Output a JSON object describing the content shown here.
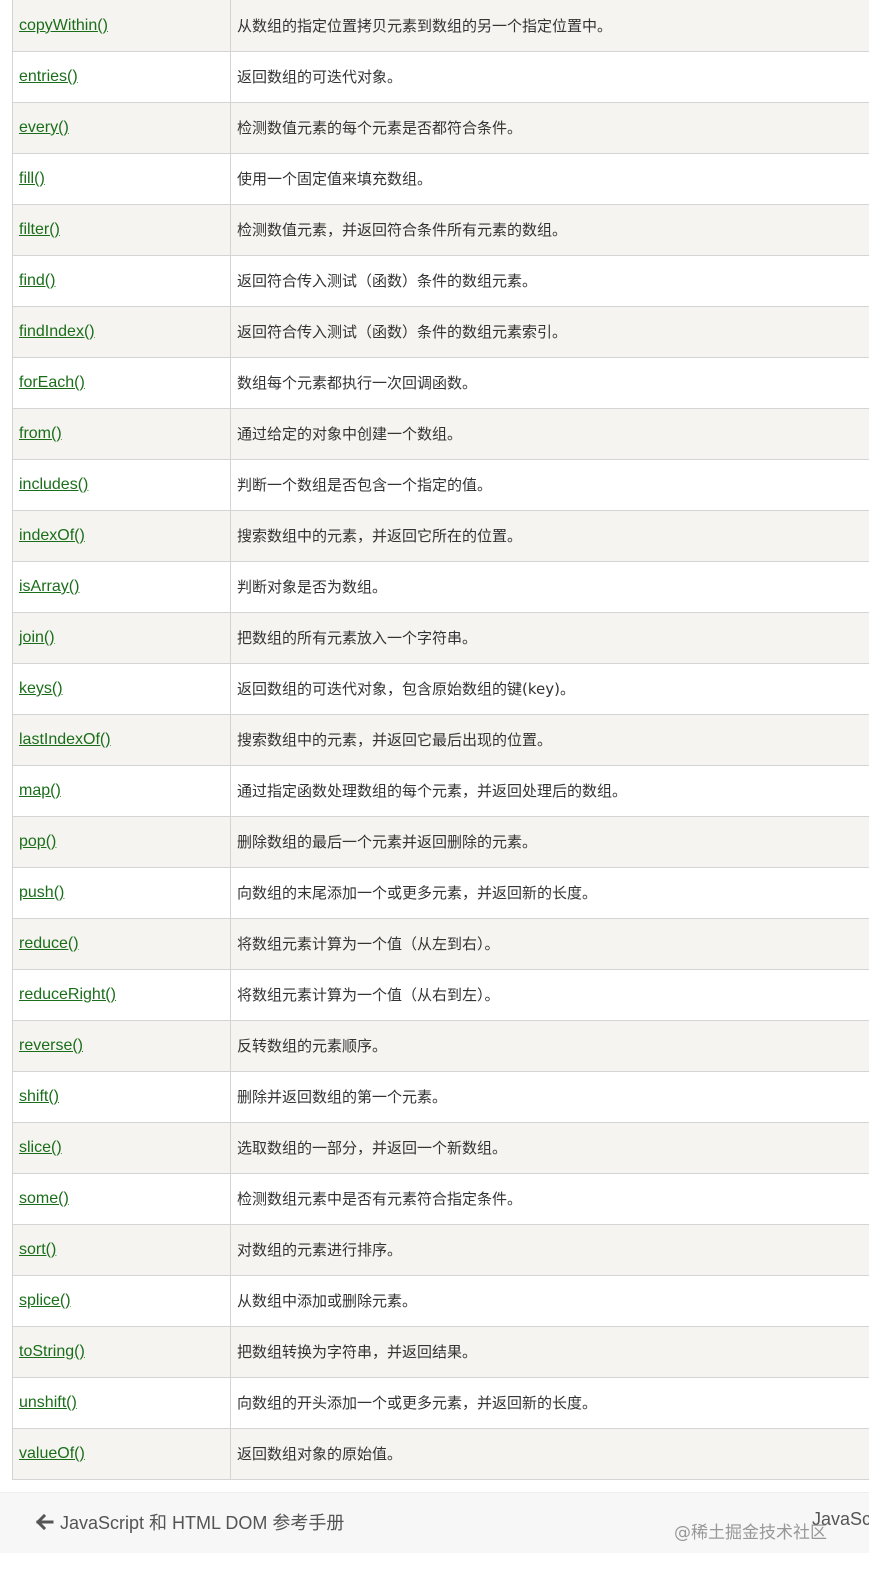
{
  "methods": [
    {
      "name": "copyWithin()",
      "desc": "从数组的指定位置拷贝元素到数组的另一个指定位置中。"
    },
    {
      "name": "entries()",
      "desc": "返回数组的可迭代对象。"
    },
    {
      "name": "every()",
      "desc": "检测数值元素的每个元素是否都符合条件。"
    },
    {
      "name": "fill()",
      "desc": "使用一个固定值来填充数组。"
    },
    {
      "name": "filter()",
      "desc": "检测数值元素，并返回符合条件所有元素的数组。"
    },
    {
      "name": "find()",
      "desc": "返回符合传入测试（函数）条件的数组元素。"
    },
    {
      "name": "findIndex()",
      "desc": "返回符合传入测试（函数）条件的数组元素索引。"
    },
    {
      "name": "forEach()",
      "desc": "数组每个元素都执行一次回调函数。"
    },
    {
      "name": "from()",
      "desc": "通过给定的对象中创建一个数组。"
    },
    {
      "name": "includes()",
      "desc": "判断一个数组是否包含一个指定的值。"
    },
    {
      "name": "indexOf()",
      "desc": "搜索数组中的元素，并返回它所在的位置。"
    },
    {
      "name": "isArray()",
      "desc": "判断对象是否为数组。"
    },
    {
      "name": "join()",
      "desc": "把数组的所有元素放入一个字符串。"
    },
    {
      "name": "keys()",
      "desc": "返回数组的可迭代对象，包含原始数组的键(key)。"
    },
    {
      "name": "lastIndexOf()",
      "desc": "搜索数组中的元素，并返回它最后出现的位置。"
    },
    {
      "name": "map()",
      "desc": "通过指定函数处理数组的每个元素，并返回处理后的数组。"
    },
    {
      "name": "pop()",
      "desc": "删除数组的最后一个元素并返回删除的元素。"
    },
    {
      "name": "push()",
      "desc": "向数组的末尾添加一个或更多元素，并返回新的长度。"
    },
    {
      "name": "reduce()",
      "desc": "将数组元素计算为一个值（从左到右）。"
    },
    {
      "name": "reduceRight()",
      "desc": "将数组元素计算为一个值（从右到左）。"
    },
    {
      "name": "reverse()",
      "desc": "反转数组的元素顺序。"
    },
    {
      "name": "shift()",
      "desc": "删除并返回数组的第一个元素。"
    },
    {
      "name": "slice()",
      "desc": "选取数组的一部分，并返回一个新数组。"
    },
    {
      "name": "some()",
      "desc": "检测数组元素中是否有元素符合指定条件。"
    },
    {
      "name": "sort()",
      "desc": "对数组的元素进行排序。"
    },
    {
      "name": "splice()",
      "desc": "从数组中添加或删除元素。"
    },
    {
      "name": "toString()",
      "desc": "把数组转换为字符串，并返回结果。"
    },
    {
      "name": "unshift()",
      "desc": "向数组的开头添加一个或更多元素，并返回新的长度。"
    },
    {
      "name": "valueOf()",
      "desc": "返回数组对象的原始值。"
    }
  ],
  "footer": {
    "prev_label": "JavaScript 和 HTML DOM 参考手册",
    "next_label": "JavaScr"
  },
  "watermark": "@稀土掘金技术社区",
  "colors": {
    "link": "#1a6e1a",
    "row_alt": "#f6f4f0",
    "border": "#d4d4d4"
  }
}
